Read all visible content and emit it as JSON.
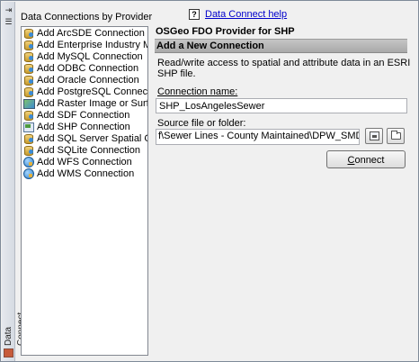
{
  "strip": {
    "title": "Data Connect",
    "buttons": [
      "pin-icon",
      "properties-icon"
    ]
  },
  "help": {
    "icon_text": "?",
    "link_label": "Data Connect help"
  },
  "providers": {
    "header": "Data Connections by Provider",
    "items": [
      {
        "label": "Add ArcSDE Connection",
        "icon": "database-icon"
      },
      {
        "label": "Add Enterprise Industry Model C",
        "icon": "database-icon"
      },
      {
        "label": "Add MySQL Connection",
        "icon": "database-icon"
      },
      {
        "label": "Add ODBC Connection",
        "icon": "database-icon"
      },
      {
        "label": "Add Oracle Connection",
        "icon": "database-icon"
      },
      {
        "label": "Add PostgreSQL Connection",
        "icon": "database-icon"
      },
      {
        "label": "Add Raster Image or Surface Co",
        "icon": "raster-icon"
      },
      {
        "label": "Add SDF Connection",
        "icon": "database-icon"
      },
      {
        "label": "Add SHP Connection",
        "icon": "shapefile-icon"
      },
      {
        "label": "Add SQL Server Spatial Connect",
        "icon": "database-icon"
      },
      {
        "label": "Add SQLite Connection",
        "icon": "database-icon"
      },
      {
        "label": "Add WFS Connection",
        "icon": "globe-icon"
      },
      {
        "label": "Add WMS Connection",
        "icon": "globe-icon"
      }
    ]
  },
  "form": {
    "provider_title": "OSGeo FDO Provider for SHP",
    "section_title": "Add a New Connection",
    "description": "Read/write access to spatial and attribute data in an ESRI SHP file.",
    "connection_name_label": "Connection name:",
    "connection_name_value": "SHP_LosAngelesSewer",
    "source_label": "Source file or folder:",
    "source_value": "f\\Sewer Lines - County Maintained\\DPW_SMD_swr_pp.shp",
    "connect_label_first": "C",
    "connect_label_rest": "onnect"
  }
}
